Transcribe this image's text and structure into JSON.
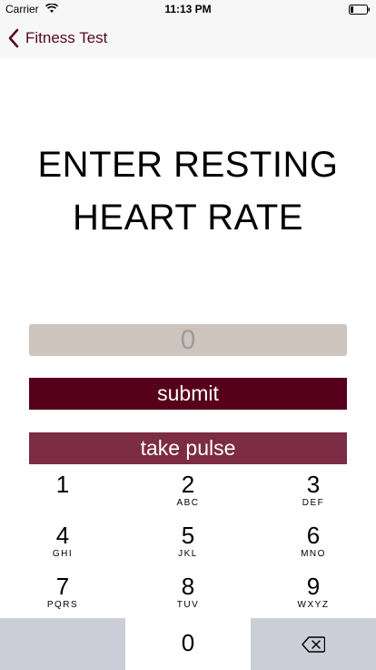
{
  "status_bar": {
    "carrier": "Carrier",
    "time": "11:13 PM"
  },
  "nav": {
    "back_label": "Fitness Test",
    "accent_color": "#57071f"
  },
  "heading": {
    "line1": "ENTER RESTING",
    "line2": "HEART RATE"
  },
  "input": {
    "placeholder": "0",
    "value": ""
  },
  "buttons": {
    "submit": "submit",
    "take_pulse": "take pulse",
    "submit_color": "#57001c",
    "take_pulse_color": "#7c2c45"
  },
  "keypad": {
    "keys": [
      {
        "digit": "1",
        "letters": ""
      },
      {
        "digit": "2",
        "letters": "ABC"
      },
      {
        "digit": "3",
        "letters": "DEF"
      },
      {
        "digit": "4",
        "letters": "GHI"
      },
      {
        "digit": "5",
        "letters": "JKL"
      },
      {
        "digit": "6",
        "letters": "MNO"
      },
      {
        "digit": "7",
        "letters": "PQRS"
      },
      {
        "digit": "8",
        "letters": "TUV"
      },
      {
        "digit": "9",
        "letters": "WXYZ"
      }
    ],
    "zero": "0",
    "backspace_icon": "backspace-icon"
  }
}
